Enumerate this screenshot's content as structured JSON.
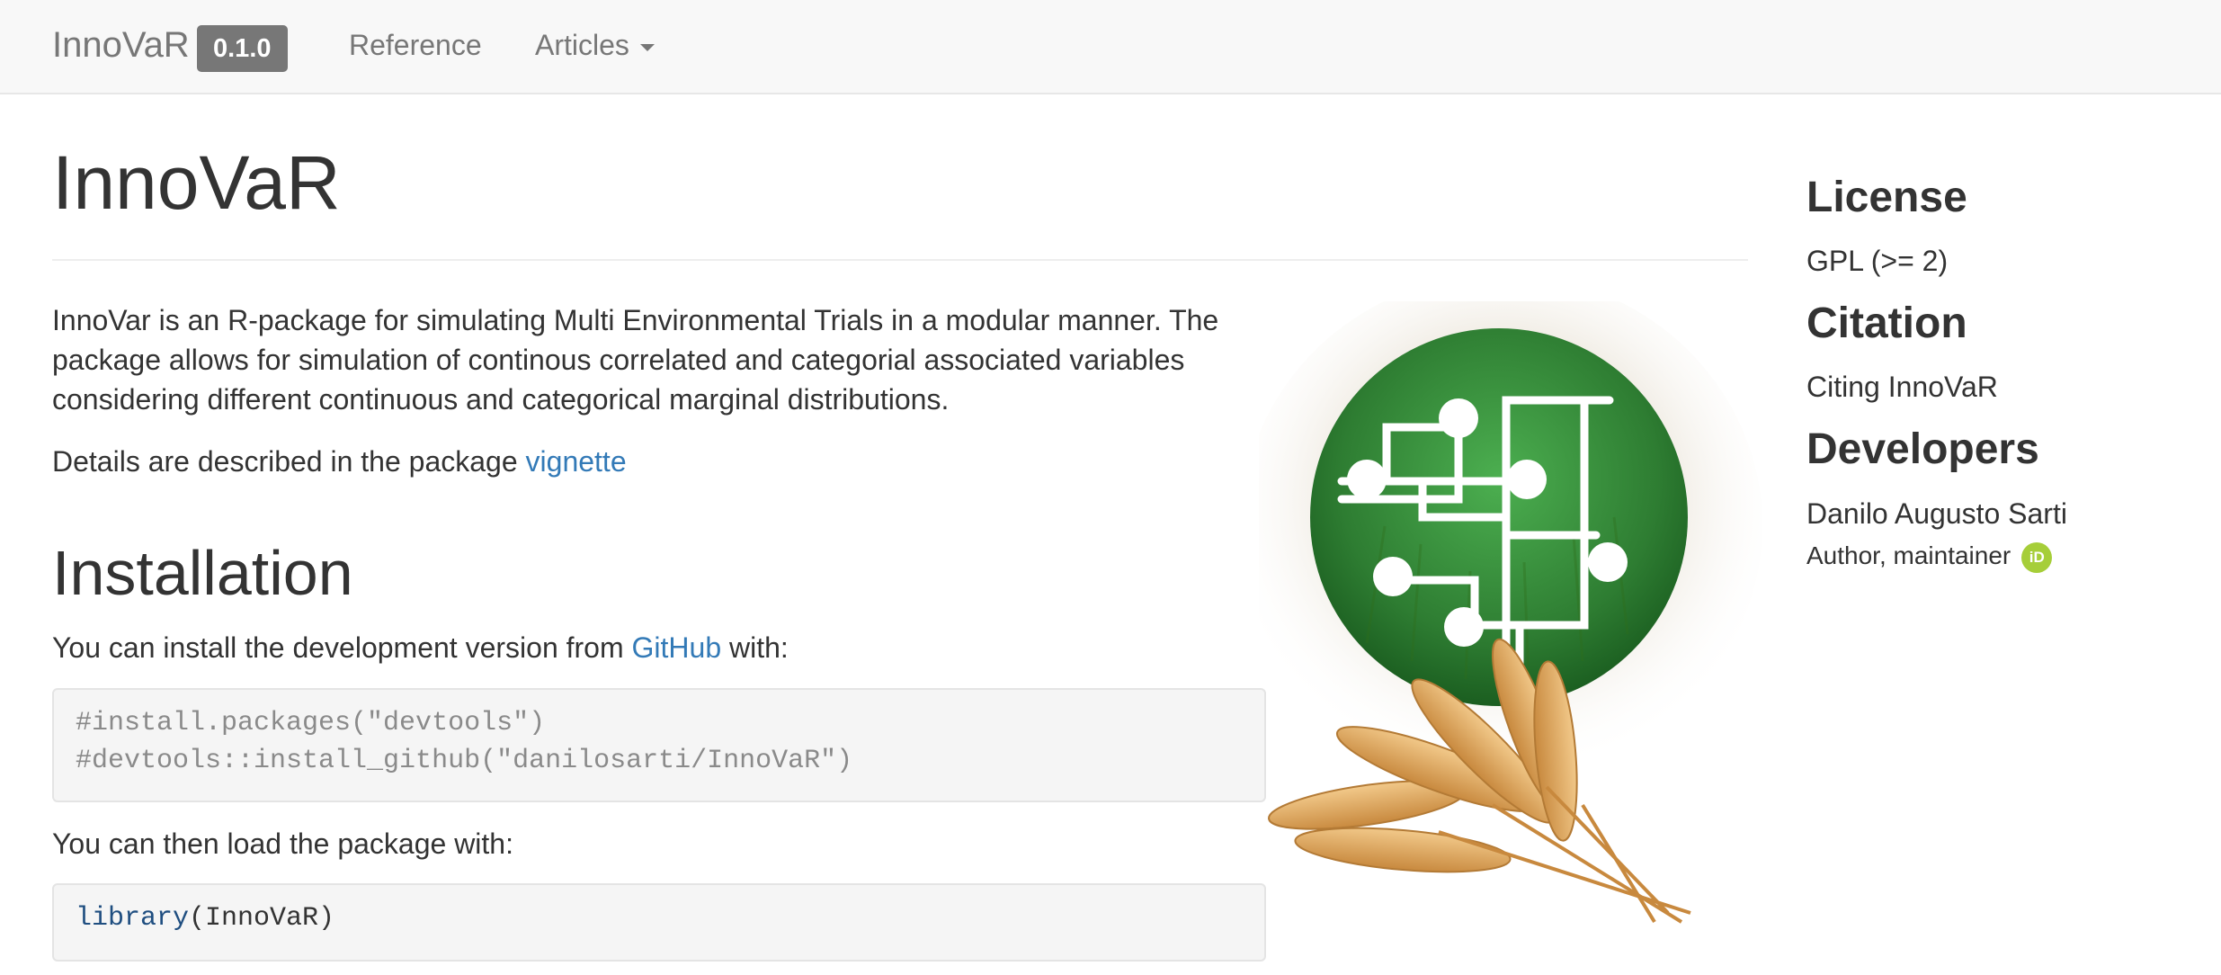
{
  "navbar": {
    "brand": "InnoVaR",
    "version": "0.1.0",
    "items": [
      {
        "label": "Reference"
      },
      {
        "label": "Articles"
      }
    ]
  },
  "main": {
    "title": "InnoVaR",
    "intro": "InnoVar is an R-package for simulating Multi Environmental Trials in a modular manner. The package allows for simulation of continous correlated and categorial associated variables considering different continuous and categorical marginal distributions.",
    "details_prefix": "Details are described in the package ",
    "details_link": "vignette",
    "installation_heading": "Installation",
    "install_prefix": "You can install the development version from ",
    "install_link": "GitHub",
    "install_suffix": " with:",
    "code1": [
      "#install.packages(\"devtools\")",
      "#devtools::install_github(\"danilosarti/InnoVaR\")"
    ],
    "load_text": "You can then load the package with:",
    "code2": {
      "fn": "library",
      "arg": "(InnoVaR)"
    }
  },
  "sidebar": {
    "license_heading": "License",
    "license_value": "GPL (>= 2)",
    "citation_heading": "Citation",
    "citation_link": "Citing InnoVaR",
    "developers_heading": "Developers",
    "developer_name": "Danilo Augusto Sarti",
    "developer_role": "Author, maintainer",
    "orcid_badge": "iD"
  },
  "colors": {
    "link": "#337ab7",
    "navbar_bg": "#f8f8f8",
    "version_badge": "#777777",
    "orcid": "#a6ce39",
    "logo_green": "#2e7d32"
  },
  "icons": [
    "caret-down-icon",
    "orcid-icon",
    "innovar-hex-logo"
  ]
}
